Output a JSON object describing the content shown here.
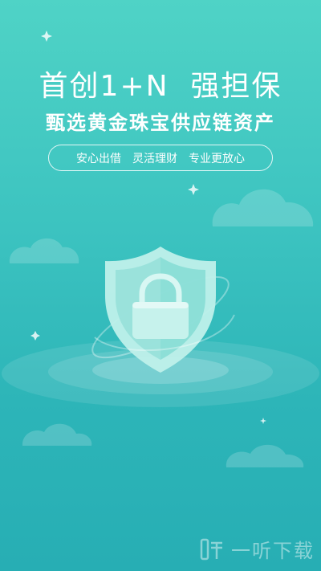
{
  "hero": {
    "headline": "首创1+N  强担保",
    "subline": "甄选黄金珠宝供应链资产"
  },
  "tagline": {
    "items": [
      "安心出借",
      "灵活理财",
      "专业更放心"
    ]
  },
  "watermark": {
    "text": "一听下载"
  },
  "colors": {
    "background_top": "#4fd3c6",
    "background_bottom": "#27aeb4",
    "shield": "#c9f3ee",
    "lock": "#9fe0da"
  }
}
